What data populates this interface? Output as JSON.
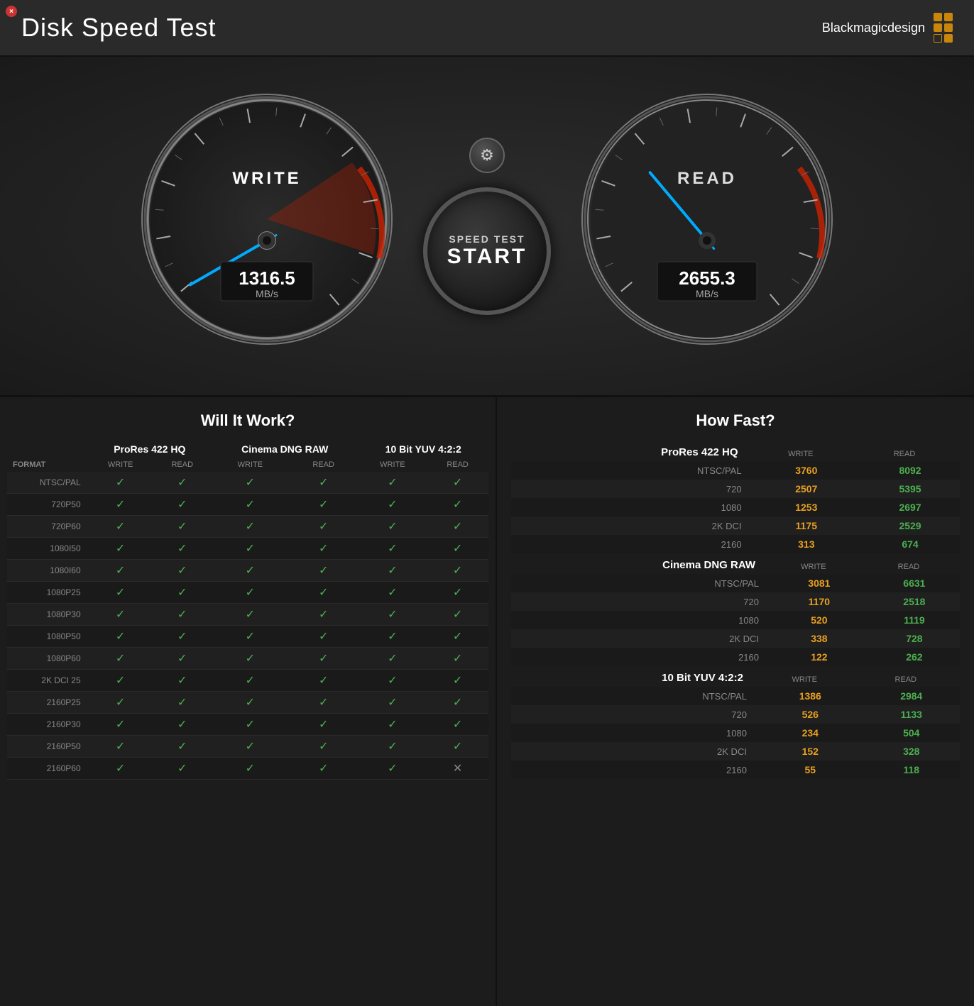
{
  "app": {
    "title": "Disk Speed Test",
    "brand": "Blackmagicdesign"
  },
  "header": {
    "close_label": "×"
  },
  "gauges": {
    "write": {
      "label": "WRITE",
      "value": "1316.5",
      "unit": "MB/s",
      "needle_angle": -145
    },
    "read": {
      "label": "READ",
      "value": "2655.3",
      "unit": "MB/s",
      "needle_angle": -60
    },
    "settings_icon": "⚙",
    "start_top": "SPEED TEST",
    "start_main": "START"
  },
  "will_it_work": {
    "title": "Will It Work?",
    "columns": {
      "format": "FORMAT",
      "groups": [
        {
          "name": "ProRes 422 HQ",
          "sub": [
            "WRITE",
            "READ"
          ]
        },
        {
          "name": "Cinema DNG RAW",
          "sub": [
            "WRITE",
            "READ"
          ]
        },
        {
          "name": "10 Bit YUV 4:2:2",
          "sub": [
            "WRITE",
            "READ"
          ]
        }
      ]
    },
    "rows": [
      {
        "format": "NTSC/PAL",
        "values": [
          1,
          1,
          1,
          1,
          1,
          1
        ]
      },
      {
        "format": "720p50",
        "values": [
          1,
          1,
          1,
          1,
          1,
          1
        ]
      },
      {
        "format": "720p60",
        "values": [
          1,
          1,
          1,
          1,
          1,
          1
        ]
      },
      {
        "format": "1080i50",
        "values": [
          1,
          1,
          1,
          1,
          1,
          1
        ]
      },
      {
        "format": "1080i60",
        "values": [
          1,
          1,
          1,
          1,
          1,
          1
        ]
      },
      {
        "format": "1080p25",
        "values": [
          1,
          1,
          1,
          1,
          1,
          1
        ]
      },
      {
        "format": "1080p30",
        "values": [
          1,
          1,
          1,
          1,
          1,
          1
        ]
      },
      {
        "format": "1080p50",
        "values": [
          1,
          1,
          1,
          1,
          1,
          1
        ]
      },
      {
        "format": "1080p60",
        "values": [
          1,
          1,
          1,
          1,
          1,
          1
        ]
      },
      {
        "format": "2K DCI 25",
        "values": [
          1,
          1,
          1,
          1,
          1,
          1
        ]
      },
      {
        "format": "2160p25",
        "values": [
          1,
          1,
          1,
          1,
          1,
          1
        ]
      },
      {
        "format": "2160p30",
        "values": [
          1,
          1,
          1,
          1,
          1,
          1
        ]
      },
      {
        "format": "2160p50",
        "values": [
          1,
          1,
          1,
          1,
          1,
          1
        ]
      },
      {
        "format": "2160p60",
        "values": [
          1,
          1,
          1,
          1,
          1,
          0
        ]
      }
    ]
  },
  "how_fast": {
    "title": "How Fast?",
    "groups": [
      {
        "name": "ProRes 422 HQ",
        "rows": [
          {
            "label": "NTSC/PAL",
            "write": "3760",
            "read": "8092"
          },
          {
            "label": "720",
            "write": "2507",
            "read": "5395"
          },
          {
            "label": "1080",
            "write": "1253",
            "read": "2697"
          },
          {
            "label": "2K DCI",
            "write": "1175",
            "read": "2529"
          },
          {
            "label": "2160",
            "write": "313",
            "read": "674"
          }
        ]
      },
      {
        "name": "Cinema DNG RAW",
        "rows": [
          {
            "label": "NTSC/PAL",
            "write": "3081",
            "read": "6631"
          },
          {
            "label": "720",
            "write": "1170",
            "read": "2518"
          },
          {
            "label": "1080",
            "write": "520",
            "read": "1119"
          },
          {
            "label": "2K DCI",
            "write": "338",
            "read": "728"
          },
          {
            "label": "2160",
            "write": "122",
            "read": "262"
          }
        ]
      },
      {
        "name": "10 Bit YUV 4:2:2",
        "rows": [
          {
            "label": "NTSC/PAL",
            "write": "1386",
            "read": "2984"
          },
          {
            "label": "720",
            "write": "526",
            "read": "1133"
          },
          {
            "label": "1080",
            "write": "234",
            "read": "504"
          },
          {
            "label": "2K DCI",
            "write": "152",
            "read": "328"
          },
          {
            "label": "2160",
            "write": "55",
            "read": "118"
          }
        ]
      }
    ]
  }
}
